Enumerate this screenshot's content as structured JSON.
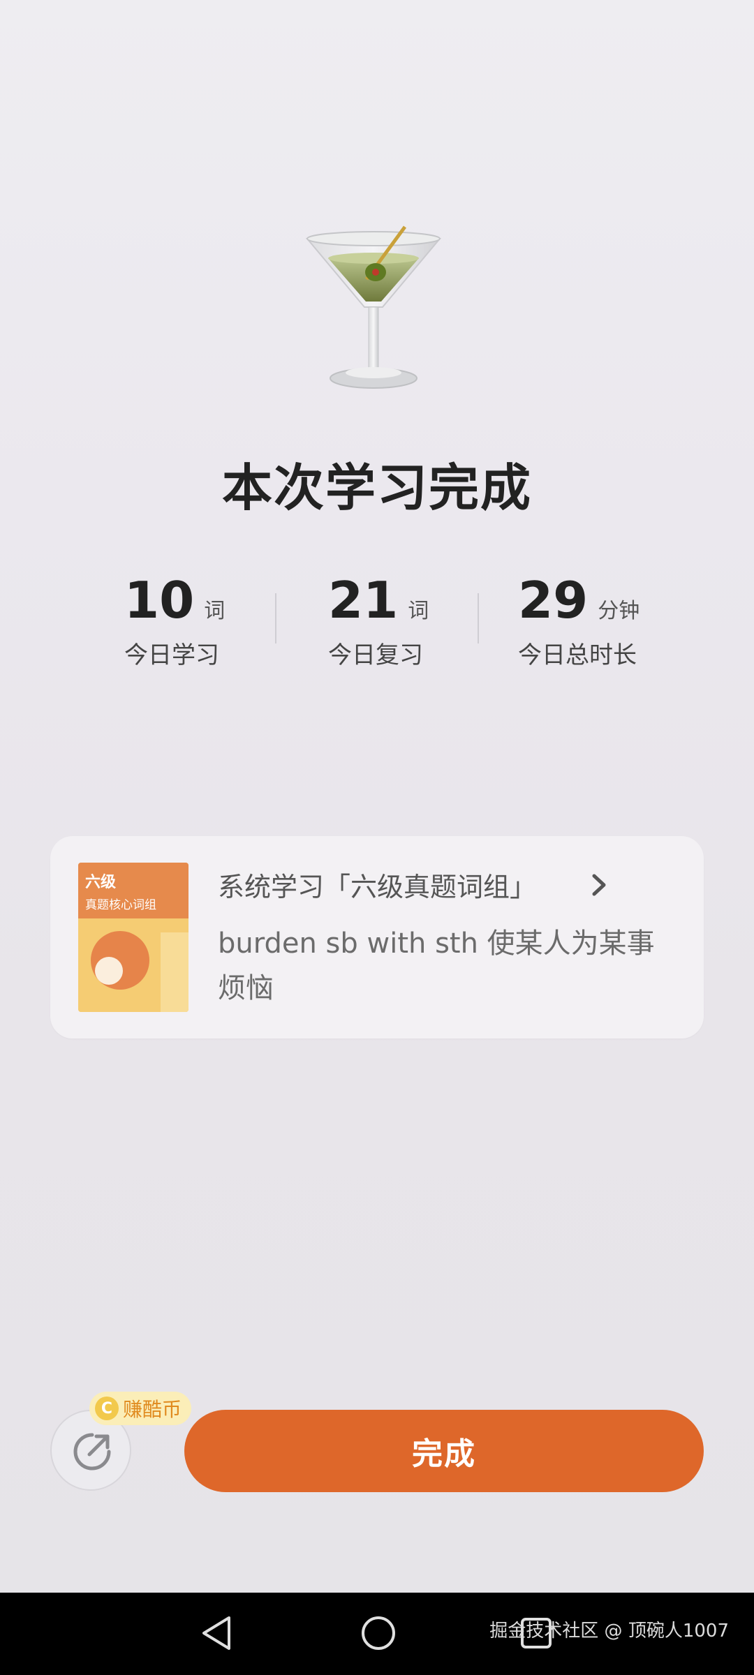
{
  "title": "本次学习完成",
  "stats": [
    {
      "value": "10",
      "unit": "词",
      "label": "今日学习"
    },
    {
      "value": "21",
      "unit": "词",
      "label": "今日复习"
    },
    {
      "value": "29",
      "unit": "分钟",
      "label": "今日总时长"
    }
  ],
  "card": {
    "book_title": "六级",
    "book_subtitle": "真题核心词组",
    "heading": "系统学习「六级真题词组」",
    "description": "burden sb with sth 使某人为某事烦恼"
  },
  "actions": {
    "coin_badge": "赚酷币",
    "coin_symbol": "C",
    "done_label": "完成"
  },
  "watermark": "掘金技术社区 @ 顶碗人1007",
  "icons": {
    "hero": "martini-glass-icon",
    "share": "share-icon",
    "chevron": "chevron-right-icon"
  },
  "colors": {
    "accent": "#de672a",
    "coin_bg": "#fbeeb8",
    "coin_text": "#e08a1e"
  }
}
